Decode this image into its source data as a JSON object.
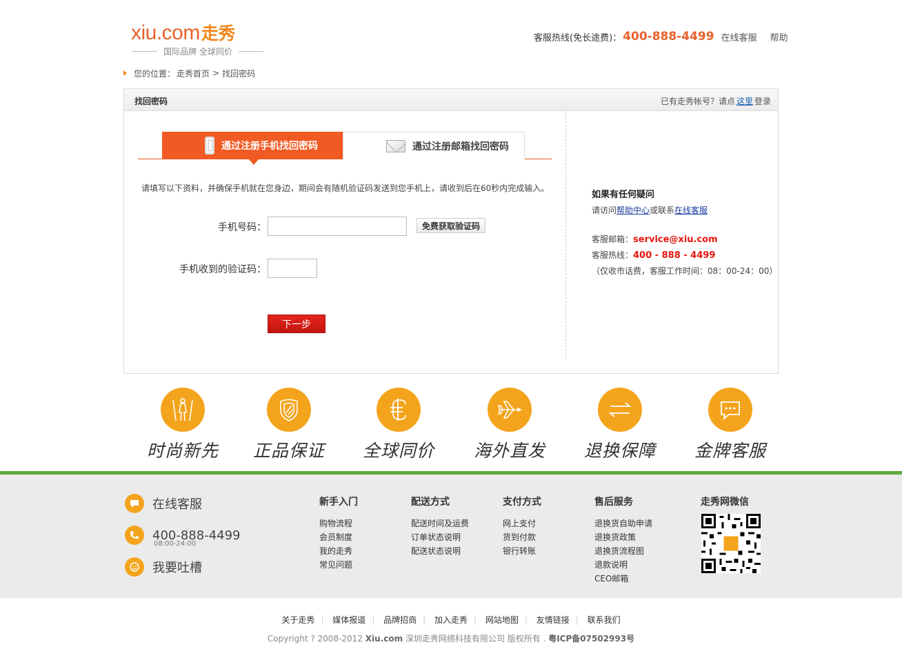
{
  "header": {
    "logo_main": "xiu.com",
    "logo_cn": "走秀",
    "logo_sub": "国际品牌 全球同价",
    "hotline_label": "客服热线(免长途费)：",
    "hotline_number": "400-888-4499",
    "online_service": "在线客服",
    "help": "帮助"
  },
  "breadcrumb": {
    "prefix": "您的位置：",
    "home": "走秀首页",
    "separator": ">",
    "current": "找回密码"
  },
  "panel": {
    "title": "找回密码",
    "login_prompt": "已有走秀帐号？请点",
    "login_link": "这里",
    "login_suffix": "登录"
  },
  "tabs": [
    {
      "label": "通过注册手机找回密码",
      "active": true,
      "icon": "phone-icon"
    },
    {
      "label": "通过注册邮箱找回密码",
      "active": false,
      "icon": "mail-icon"
    }
  ],
  "form": {
    "instruction": "请填写以下资料，并确保手机就在您身边，期间会有随机验证码发送到您手机上，请收到后在60秒内完成输入。",
    "phone_label": "手机号码：",
    "phone_value": "",
    "get_code_button": "免费获取验证码",
    "code_label": "手机收到的验证码：",
    "code_value": "",
    "next_button": "下一步"
  },
  "help_box": {
    "title": "如果有任何疑问",
    "visit_prefix": "请访问",
    "help_center": "帮助中心",
    "or_contact": "或联系",
    "online_service": "在线客服",
    "email_label": "客服邮箱：",
    "email": "service@xiu.com",
    "hotline_label": "客服热线：",
    "hotline": "400 - 888 - 4499",
    "note": "（仅收市话费，客服工作时间：08：00-24：00）"
  },
  "features": [
    {
      "label": "时尚新先",
      "icon": "fashion-icon"
    },
    {
      "label": "正品保证",
      "icon": "shield-icon"
    },
    {
      "label": "全球同价",
      "icon": "currency-icon"
    },
    {
      "label": "海外直发",
      "icon": "airplane-icon"
    },
    {
      "label": "退换保障",
      "icon": "exchange-icon"
    },
    {
      "label": "金牌客服",
      "icon": "chat-icon"
    }
  ],
  "footer": {
    "service_online": "在线客服",
    "service_phone": "400-888-4499",
    "service_hours": "08:00-24:00",
    "service_feedback": "我要吐槽",
    "columns": [
      {
        "title": "新手入门",
        "items": [
          "购物流程",
          "会员制度",
          "我的走秀",
          "常见问题"
        ]
      },
      {
        "title": "配送方式",
        "items": [
          "配送时间及运费",
          "订单状态说明",
          "配送状态说明"
        ]
      },
      {
        "title": "支付方式",
        "items": [
          "网上支付",
          "货到付款",
          "银行转账"
        ]
      },
      {
        "title": "售后服务",
        "items": [
          "退换货自助申请",
          "退换货政策",
          "退换货流程图",
          "退款说明",
          "CEO邮箱"
        ]
      },
      {
        "title": "走秀网微信",
        "items": []
      }
    ],
    "links": [
      "关于走秀",
      "媒体报道",
      "品牌招商",
      "加入走秀",
      "网站地图",
      "友情链接",
      "联系我们"
    ],
    "copyright_prefix": "Copyright ? 2008-2012",
    "copyright_site": "Xiu.com",
    "copyright_company": "深圳走秀网络科技有限公司 版权所有 .",
    "icp": "粤ICP备07502993号"
  },
  "colors": {
    "brand_orange": "#f15a22",
    "accent_yellow": "#f4a41c",
    "footer_green": "#5fa83a",
    "button_red": "#d01c14"
  }
}
